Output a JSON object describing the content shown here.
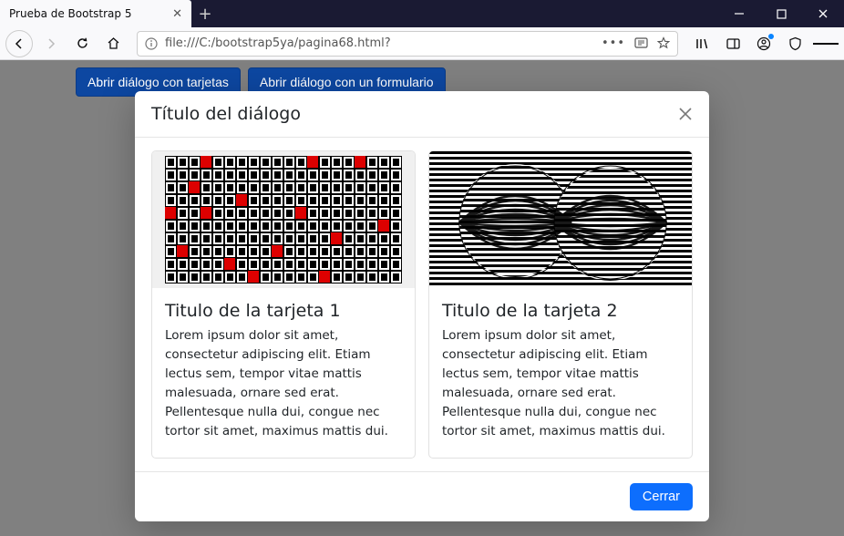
{
  "browser": {
    "tab_title": "Prueba de Bootstrap 5",
    "url": "file:///C:/bootstrap5ya/pagina68.html?"
  },
  "page": {
    "buttons": {
      "open_cards": "Abrir diálogo con tarjetas",
      "open_form": "Abrir diálogo con un formulario"
    }
  },
  "modal": {
    "title": "Título del diálogo",
    "close_btn": "Cerrar",
    "cards": [
      {
        "title": "Titulo de la tarjeta 1",
        "text": "Lorem ipsum dolor sit amet, consectetur adipiscing elit. Etiam lectus sem, tempor vitae mattis malesuada, ornare sed erat. Pellentesque nulla dui, congue nec tortor sit amet, maximus mattis dui."
      },
      {
        "title": "Titulo de la tarjeta 2",
        "text": "Lorem ipsum dolor sit amet, consectetur adipiscing elit. Etiam lectus sem, tempor vitae mattis malesuada, ornare sed erat. Pellentesque nulla dui, congue nec tortor sit amet, maximus mattis dui."
      }
    ]
  }
}
